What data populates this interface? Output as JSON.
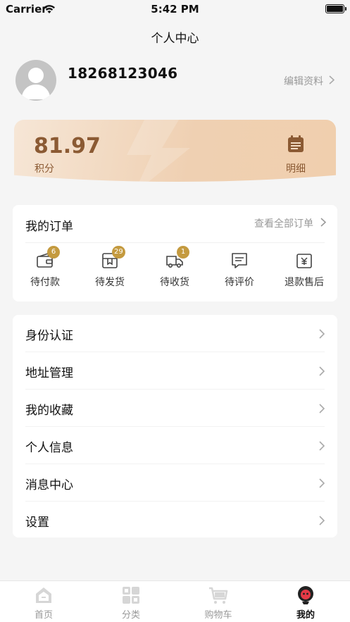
{
  "status_bar": {
    "carrier": "Carrier",
    "time": "5:42 PM"
  },
  "nav": {
    "title": "个人中心"
  },
  "profile": {
    "phone": "18268123046",
    "edit_label": "编辑资料"
  },
  "points": {
    "value": "81.97",
    "label": "积分",
    "detail_label": "明细"
  },
  "orders": {
    "title": "我的订单",
    "view_all": "查看全部订单",
    "items": [
      {
        "label": "待付款",
        "badge": "6",
        "icon": "wallet-icon"
      },
      {
        "label": "待发货",
        "badge": "29",
        "icon": "package-icon"
      },
      {
        "label": "待收货",
        "badge": "1",
        "icon": "truck-icon"
      },
      {
        "label": "待评价",
        "badge": "",
        "icon": "comment-icon"
      },
      {
        "label": "退款售后",
        "badge": "",
        "icon": "refund-icon"
      }
    ]
  },
  "menu": {
    "items": [
      {
        "label": "身份认证"
      },
      {
        "label": "地址管理"
      },
      {
        "label": "我的收藏"
      },
      {
        "label": "个人信息"
      },
      {
        "label": "消息中心"
      },
      {
        "label": "设置"
      }
    ]
  },
  "tabbar": {
    "items": [
      {
        "label": "首页",
        "icon": "home-icon"
      },
      {
        "label": "分类",
        "icon": "category-icon"
      },
      {
        "label": "购物车",
        "icon": "cart-icon"
      },
      {
        "label": "我的",
        "icon": "profile-icon",
        "active": true
      }
    ]
  },
  "colors": {
    "accent": "#8b5a33",
    "badge": "#c49a3f",
    "card_gradient_start": "#f6e6d6",
    "card_gradient_end": "#efd0b2"
  }
}
